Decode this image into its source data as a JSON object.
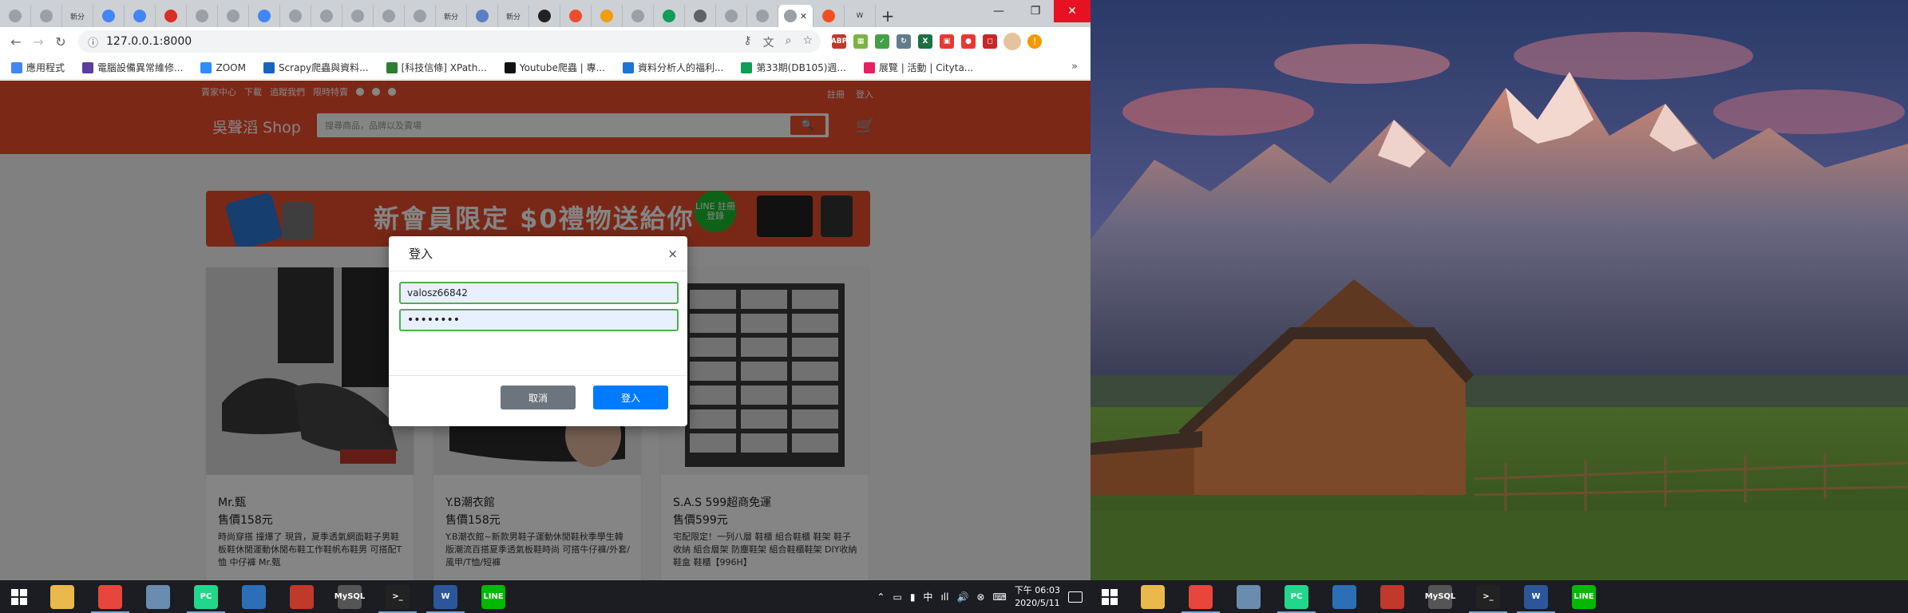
{
  "browser": {
    "tabs": [
      {
        "label": "",
        "icon": "globe-icon",
        "color": "#9aa0a6"
      },
      {
        "label": "",
        "icon": "globe-icon",
        "color": "#9aa0a6"
      },
      {
        "label": "新分",
        "icon": "newtab-icon",
        "color": "#cdd0d4"
      },
      {
        "label": "",
        "icon": "google-icon",
        "color": "#4285f4"
      },
      {
        "label": "",
        "icon": "google-icon",
        "color": "#4285f4"
      },
      {
        "label": "",
        "icon": "gmail-icon",
        "color": "#d93025"
      },
      {
        "label": "",
        "icon": "globe-icon",
        "color": "#9aa0a6"
      },
      {
        "label": "",
        "icon": "globe-icon",
        "color": "#9aa0a6"
      },
      {
        "label": "",
        "icon": "google-icon",
        "color": "#4285f4"
      },
      {
        "label": "",
        "icon": "globe-icon",
        "color": "#9aa0a6"
      },
      {
        "label": "",
        "icon": "globe-icon",
        "color": "#9aa0a6"
      },
      {
        "label": "",
        "icon": "globe-icon",
        "color": "#9aa0a6"
      },
      {
        "label": "",
        "icon": "globe-icon",
        "color": "#9aa0a6"
      },
      {
        "label": "",
        "icon": "globe-icon",
        "color": "#9aa0a6"
      },
      {
        "label": "新分",
        "icon": "newtab-icon",
        "color": "#cdd0d4"
      },
      {
        "label": "",
        "icon": "bookmark-icon",
        "color": "#5b7ec6"
      },
      {
        "label": "新分",
        "icon": "newtab-icon",
        "color": "#cdd0d4"
      },
      {
        "label": "",
        "icon": "github-icon",
        "color": "#222222"
      },
      {
        "label": "",
        "icon": "shopee-icon",
        "color": "#ee4d2d"
      },
      {
        "label": "",
        "icon": "shopee-icon",
        "color": "#f39c12"
      },
      {
        "label": "",
        "icon": "globe-icon",
        "color": "#9aa0a6"
      },
      {
        "label": "",
        "icon": "sheet-icon",
        "color": "#0f9d58"
      },
      {
        "label": "",
        "icon": "settings-icon",
        "color": "#5f6368"
      },
      {
        "label": "",
        "icon": "globe-icon",
        "color": "#9aa0a6"
      },
      {
        "label": "",
        "icon": "globe-icon",
        "color": "#9aa0a6"
      }
    ],
    "active_tab": {
      "label": "",
      "close": "✕"
    },
    "extra_tabs": [
      {
        "label": "",
        "icon": "microsoft-icon",
        "color": "#f25022"
      },
      {
        "label": "W",
        "icon": "word-icon",
        "color": "#2b579a"
      }
    ],
    "new_tab_label": "+",
    "window": {
      "minimize": "—",
      "maximize": "❐",
      "close": "✕"
    },
    "nav": {
      "back": "←",
      "forward": "→",
      "reload": "↻",
      "info": "ⓘ"
    },
    "url": "127.0.0.1:8000",
    "omnibox_icons": [
      "key-icon",
      "translate-icon",
      "zoom-icon",
      "star-icon"
    ],
    "extensions": [
      {
        "label": "ABP",
        "color": "#c0392b"
      },
      {
        "label": "▦",
        "color": "#7cb342"
      },
      {
        "label": "✓",
        "color": "#43a047"
      },
      {
        "label": "↻",
        "color": "#607d8b"
      },
      {
        "label": "X",
        "color": "#1d6f42"
      },
      {
        "label": "▣",
        "color": "#e53935"
      },
      {
        "label": "●",
        "color": "#e53935"
      },
      {
        "label": "◻",
        "color": "#c62828"
      }
    ],
    "menu_badge": "!",
    "bookmarks": [
      {
        "label": "應用程式",
        "color": "#4285f4"
      },
      {
        "label": "電腦設備異常維修...",
        "color": "#5b3fa0"
      },
      {
        "label": "ZOOM",
        "color": "#2d8cff"
      },
      {
        "label": "Scrapy爬蟲與資料...",
        "color": "#1565c0"
      },
      {
        "label": "[科技信條] XPath...",
        "color": "#2e7d32"
      },
      {
        "label": "Youtube爬蟲 | 專...",
        "color": "#111111"
      },
      {
        "label": "資料分析人的福利...",
        "color": "#1976d2"
      },
      {
        "label": "第33期(DB105)週...",
        "color": "#0f9d58"
      },
      {
        "label": "展覽 | 活動 | Cityta...",
        "color": "#e91e63"
      }
    ],
    "bookmarks_more": "»"
  },
  "shop": {
    "topnav": [
      "賣家中心",
      "下載",
      "追蹤我們",
      "限時特賣"
    ],
    "auth": [
      "註冊",
      "登入"
    ],
    "brand": "吳聲滔 Shop",
    "search_placeholder": "搜尋商品，品牌以及賣場",
    "search_icon": "🔍",
    "cart_icon": "🛒",
    "banner_text": "新會員限定 $0禮物送給你",
    "banner_line": "LINE 註冊登錄",
    "products": [
      {
        "name": "Mr.甄",
        "price": "售價158元",
        "desc": "時尚穿搭 撞爆了 現貨，夏季透氣網面鞋子男鞋 板鞋休閒運動休閒布鞋工作鞋帆布鞋男 可搭配T恤 中仔褲 Mr.甄"
      },
      {
        "name": "Y.B潮衣館",
        "price": "售價158元",
        "desc": "Y.B潮衣館~新款男鞋子運動休閒鞋秋季學生韓版潮流百搭夏季透氣板鞋時尚 可搭牛仔褲/外套/風甲/T恤/短褲"
      },
      {
        "name": "S.A.S 599超商免運",
        "price": "售價599元",
        "desc": "宅配限定！一列八層 鞋櫃 組合鞋櫃 鞋架 鞋子收納 組合層架 防塵鞋架 組合鞋櫃鞋架 DIY收納鞋盒 鞋櫃【996H】"
      }
    ],
    "modal": {
      "title": "登入",
      "close": "×",
      "username": "valosz66842",
      "password": "••••••••",
      "cancel": "取消",
      "submit": "登入"
    }
  },
  "taskbar": {
    "apps": [
      {
        "label": "",
        "icon": "file-explorer-icon",
        "color": "#e9b94b"
      },
      {
        "label": "",
        "icon": "chrome-icon",
        "color": "#e8453c",
        "running": true
      },
      {
        "label": "",
        "icon": "network-icon",
        "color": "#6a8caf"
      },
      {
        "label": "PC",
        "icon": "pycharm-icon",
        "color": "#21d789",
        "running": true
      },
      {
        "label": "",
        "icon": "tool-icon",
        "color": "#2c6fb7"
      },
      {
        "label": "",
        "icon": "git-icon",
        "color": "#c0392b"
      },
      {
        "label": "MySQL",
        "icon": "mysql-icon",
        "color": "#555555"
      },
      {
        "label": ">_",
        "icon": "terminal-icon",
        "color": "#222222",
        "running": true
      },
      {
        "label": "W",
        "icon": "word-icon",
        "color": "#2b579a",
        "running": true
      },
      {
        "label": "LINE",
        "icon": "line-icon",
        "color": "#00b900"
      }
    ],
    "tray_icons": [
      "chevron-up-icon",
      "usb-icon",
      "battery-icon",
      "ime-icon",
      "wifi-icon",
      "volume-icon",
      "stop-icon",
      "keyboard-icon"
    ],
    "time": "下午 06:03",
    "date": "2020/5/11"
  }
}
